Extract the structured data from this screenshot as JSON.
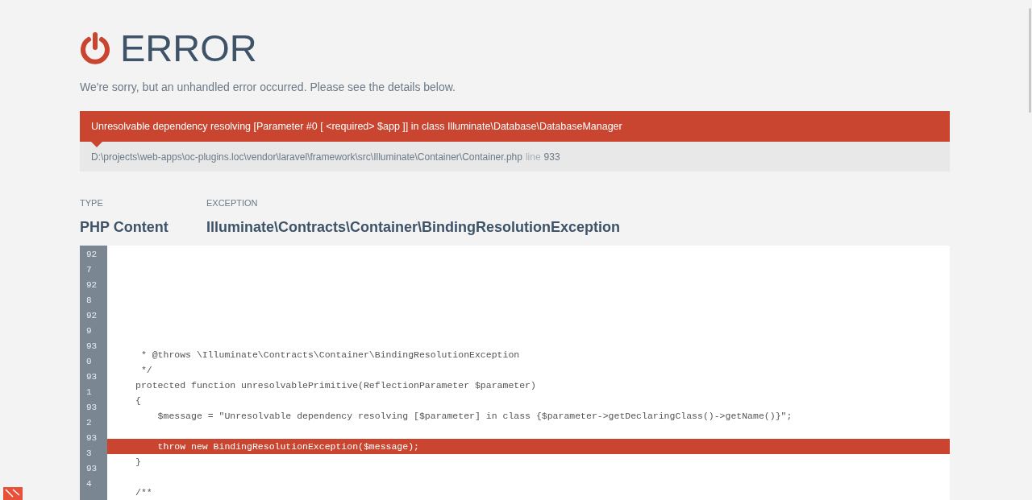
{
  "header": {
    "title": "ERROR",
    "subtitle": "We're sorry, but an unhandled error occurred. Please see the details below."
  },
  "error_message": "Unresolvable dependency resolving [Parameter #0 [ <required> $app ]] in class Illuminate\\Database\\DatabaseManager",
  "error_location": {
    "path": "D:\\projects\\web-apps\\oc-plugins.loc\\vendor\\laravel\\framework\\src\\Illuminate\\Container\\Container.php",
    "line_label": "line",
    "line": "933"
  },
  "details": [
    {
      "label": "TYPE",
      "value": "PHP Content"
    },
    {
      "label": "EXCEPTION",
      "value": "Illuminate\\Contracts\\Container\\BindingResolutionException"
    }
  ],
  "code": {
    "line_numbers": [
      "927",
      "928",
      "929",
      "930",
      "931",
      "932",
      "933",
      "934"
    ],
    "lines": [
      {
        "kind": "code",
        "text": " * @throws \\Illuminate\\Contracts\\Container\\BindingResolutionException",
        "selected": false
      },
      {
        "kind": "code",
        "text": " */",
        "selected": false
      },
      {
        "kind": "code",
        "text": "protected function unresolvablePrimitive(ReflectionParameter $parameter)",
        "selected": false
      },
      {
        "kind": "code",
        "text": "{",
        "selected": false
      },
      {
        "kind": "code",
        "text": "    $message = \"Unresolvable dependency resolving [$parameter] in class {$parameter->getDeclaringClass()->getName()}\";",
        "selected": false
      },
      {
        "kind": "blank",
        "selected": false
      },
      {
        "kind": "code",
        "text": "    throw new BindingResolutionException($message);",
        "selected": true
      },
      {
        "kind": "code",
        "text": "}",
        "selected": false
      },
      {
        "kind": "blank",
        "selected": false
      },
      {
        "kind": "code",
        "text": "/**",
        "selected": false
      }
    ]
  }
}
